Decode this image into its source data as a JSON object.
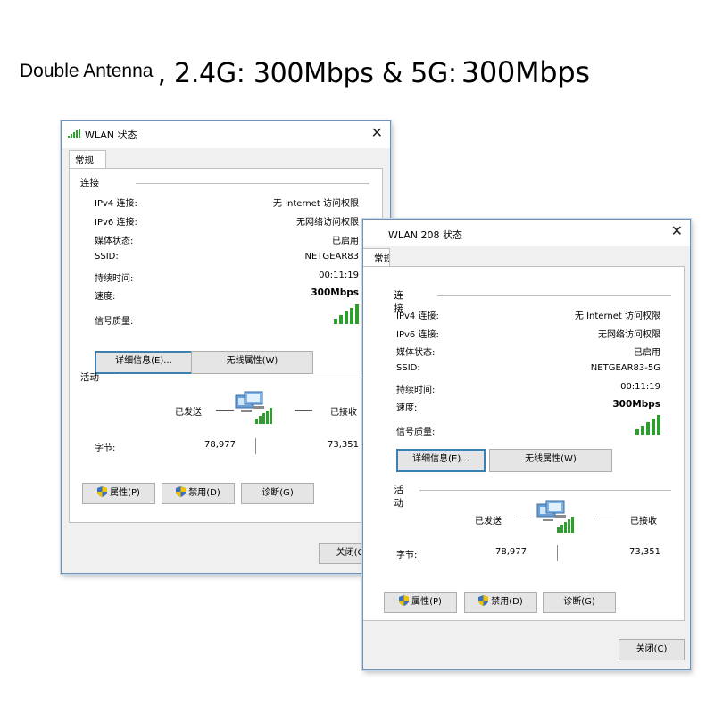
{
  "headline": {
    "part1": "Double Antenna",
    "part2": ", 2.4G: 300Mbps & 5G:",
    "part3": " 300Mbps"
  },
  "win1": {
    "title": "WLAN 状态",
    "tab": "常规",
    "section_connection": "连接",
    "fields": [
      {
        "label": "IPv4 连接:",
        "value": "无 Internet 访问权限"
      },
      {
        "label": "IPv6 连接:",
        "value": "无网络访问权限"
      },
      {
        "label": "媒体状态:",
        "value": "已启用"
      },
      {
        "label": "SSID:",
        "value": "NETGEAR83"
      },
      {
        "label": "持续时间:",
        "value": "00:11:19"
      },
      {
        "label": "速度:",
        "value": "300Mbps"
      }
    ],
    "signal_label": "信号质量:",
    "details_button": "详细信息(E)...",
    "wireless_button": "无线属性(W)",
    "section_activity": "活动",
    "sent_label": "已发送",
    "received_label": "已接收",
    "bytes_label": "字节:",
    "bytes_sent": "78,977",
    "bytes_received": "73,351",
    "properties_button": "属性(P)",
    "disable_button": "禁用(D)",
    "diagnose_button": "诊断(G)",
    "close_button": "关闭(C)"
  },
  "win2": {
    "title": "WLAN 208 状态",
    "tab": "常规",
    "section_connection": "连接",
    "fields": [
      {
        "label": "IPv4 连接:",
        "value": "无 Internet 访问权限"
      },
      {
        "label": "IPv6 连接:",
        "value": "无网络访问权限"
      },
      {
        "label": "媒体状态:",
        "value": "已启用"
      },
      {
        "label": "SSID:",
        "value": "NETGEAR83-5G"
      },
      {
        "label": "持续时间:",
        "value": "00:11:19"
      },
      {
        "label": "速度:",
        "value": "300Mbps"
      }
    ],
    "signal_label": "信号质量:",
    "details_button": "详细信息(E)...",
    "wireless_button": "无线属性(W)",
    "section_activity": "活动",
    "sent_label": "已发送",
    "received_label": "已接收",
    "bytes_label": "字节:",
    "bytes_sent": "78,977",
    "bytes_received": "73,351",
    "properties_button": "属性(P)",
    "disable_button": "禁用(D)",
    "diagnose_button": "诊断(G)",
    "close_button": "关闭(C)"
  },
  "icons": {
    "close": "close-icon",
    "wifi": "wifi-signal-icon",
    "shield": "uac-shield-icon",
    "network": "network-computers-icon"
  },
  "colors": {
    "signal_green": "#2e9e2e",
    "window_border": "#6d93b8",
    "focus_border": "#3c7fb1"
  }
}
